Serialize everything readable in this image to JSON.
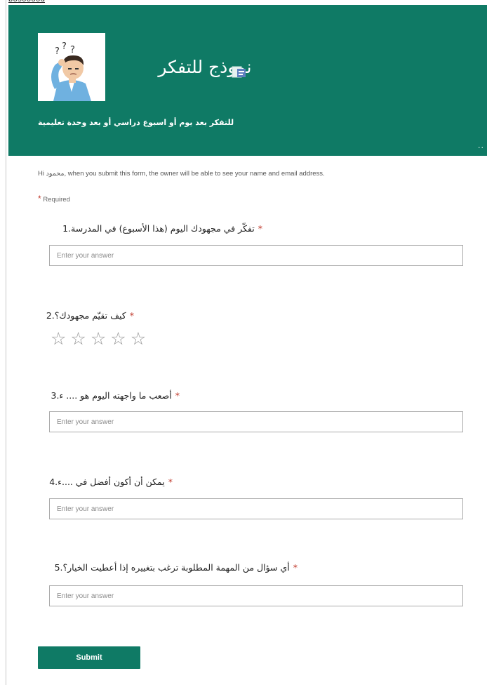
{
  "top_clip": "bosooood",
  "header": {
    "title": "نموذج للتفكر",
    "subtitle": "للتفكر بعد يوم أو اسبوع دراسي أو بعد وحدة تعليمية",
    "more_glyph": "··",
    "avatar_icon": "thinking-person-icon",
    "form_icon": "forms-icon",
    "accent": "#0f7a65"
  },
  "notice": "Hi محمود, when you submit this form, the owner will be able to see your name and email address.",
  "required": {
    "star": "*",
    "label": "Required"
  },
  "questions": [
    {
      "text": "تفكّر في مجهودك اليوم (هذا الأسبوع) في المدرسة.1",
      "placeholder": "Enter your answer"
    },
    {
      "text": "كيف تقيّم مجهودك؟.2",
      "rating_max": 5,
      "rating_value": 0,
      "star_glyph": "☆"
    },
    {
      "text": "أصعب ما واجهته اليوم هو .... ء.3",
      "placeholder": "Enter your answer"
    },
    {
      "text": "يمكن أن أكون أفضل في ....ء.4",
      "placeholder": "Enter your answer"
    },
    {
      "text": "أي سؤال من المهمة المطلوبة ترغب بتغييره إذا أعطيت الخيار؟.5",
      "placeholder": "Enter your answer"
    }
  ],
  "submit_label": "Submit"
}
